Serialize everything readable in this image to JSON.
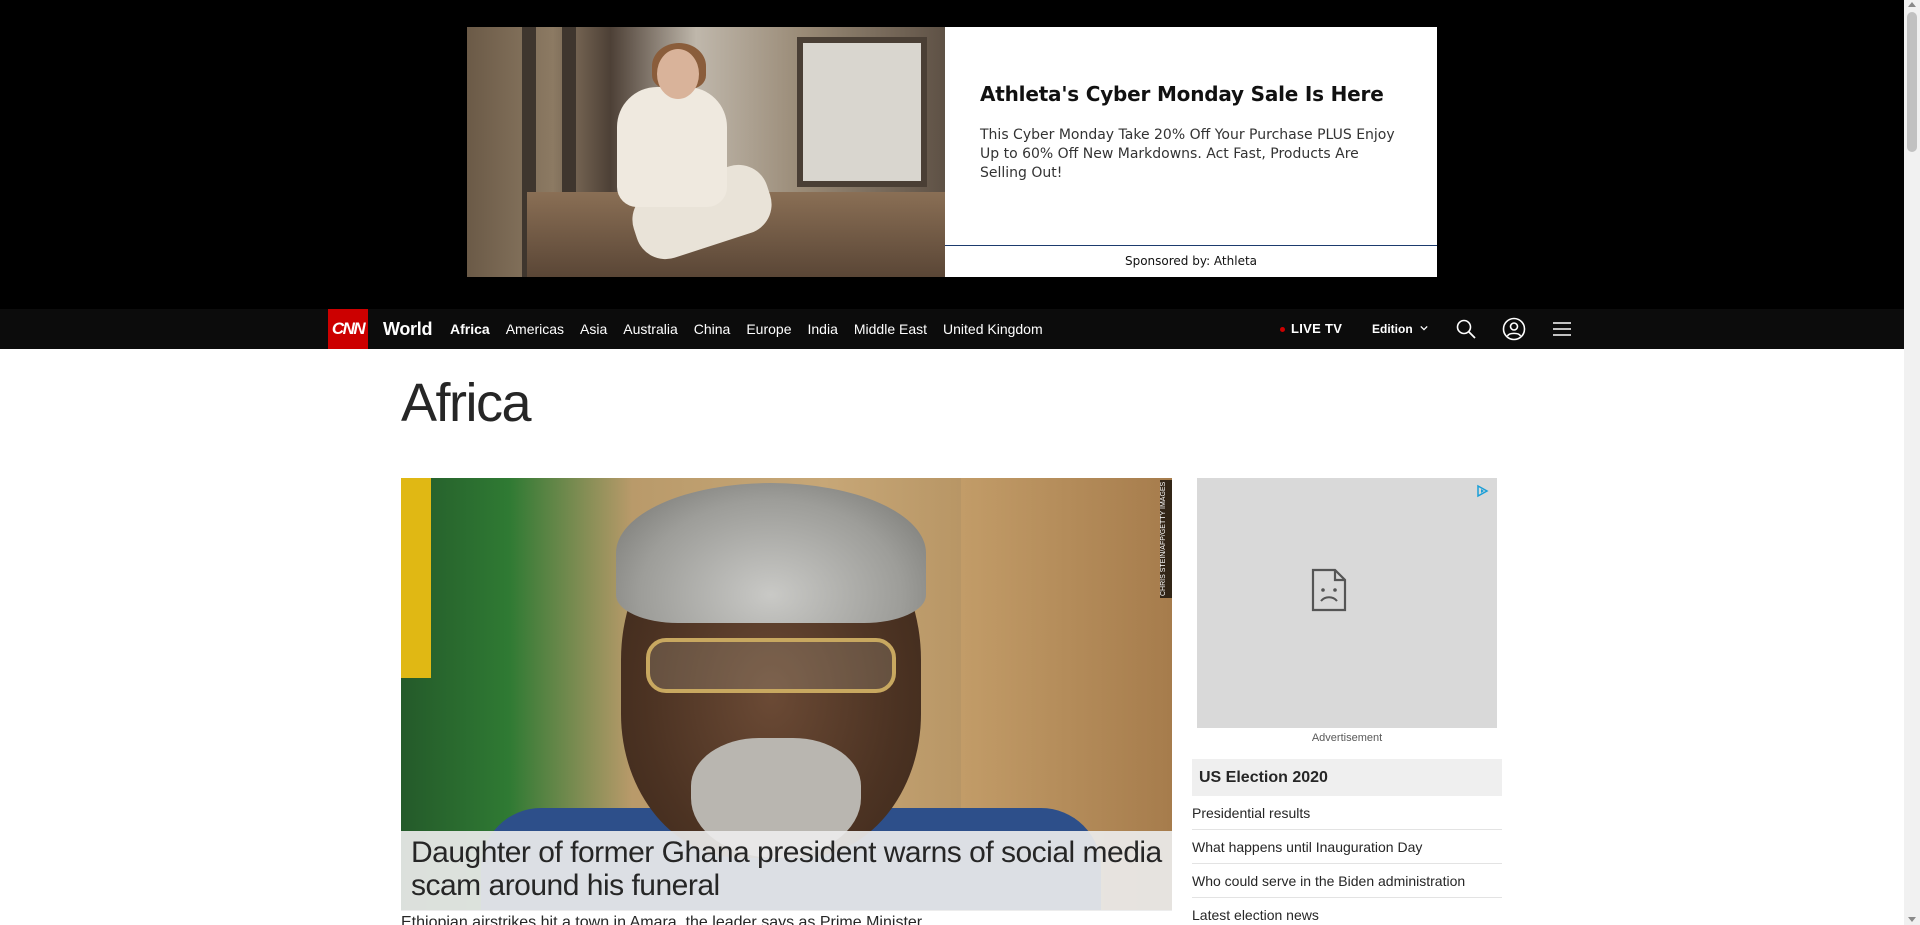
{
  "ad": {
    "title": "Athleta's Cyber Monday Sale Is Here",
    "description": "This Cyber Monday Take 20% Off Your Purchase PLUS Enjoy Up to 60% Off New Markdowns. Act Fast, Products Are Selling Out!",
    "sponsor": "Sponsored by: Athleta"
  },
  "nav": {
    "logo": "CNN",
    "section": "World",
    "links": [
      "Africa",
      "Americas",
      "Asia",
      "Australia",
      "China",
      "Europe",
      "India",
      "Middle East",
      "United Kingdom"
    ],
    "active_link": "Africa",
    "live_tv": "LIVE TV",
    "edition": "Edition",
    "icons": [
      "search-icon",
      "account-icon",
      "menu-icon"
    ]
  },
  "page": {
    "title": "Africa"
  },
  "hero": {
    "photo_credit": "CHRIS STEIN/AFP/GETTY IMAGES",
    "headline": "Daughter of former Ghana president warns of social media scam around his funeral",
    "teaser": "Ethiopian airstrikes hit a town in Amara, the leader says as Prime Minister"
  },
  "rail": {
    "ad_label": "Advertisement",
    "list_heading": "US Election 2020",
    "items": [
      "Presidential results",
      "What happens until Inauguration Day",
      "Who could serve in the Biden administration",
      "Latest election news"
    ]
  },
  "colors": {
    "brand_red": "#cc0000",
    "nav_bg": "#0c0c0c",
    "ad_band_bg": "#000000"
  }
}
